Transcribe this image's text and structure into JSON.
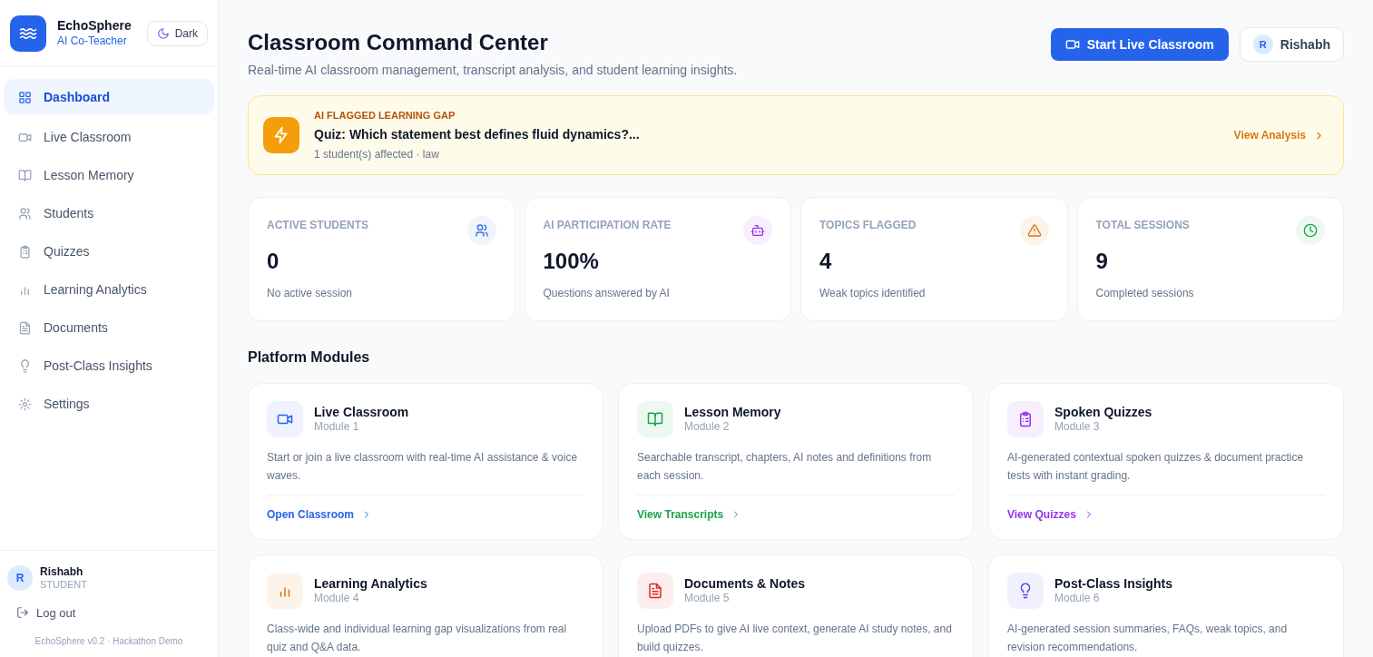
{
  "brand": {
    "name": "EchoSphere",
    "tagline": "AI Co-Teacher",
    "theme_button": "Dark"
  },
  "sidebar": {
    "items": [
      {
        "label": "Dashboard",
        "selected": true
      },
      {
        "label": "Live Classroom",
        "selected": false
      },
      {
        "label": "Lesson Memory",
        "selected": false
      },
      {
        "label": "Students",
        "selected": false
      },
      {
        "label": "Quizzes",
        "selected": false
      },
      {
        "label": "Learning Analytics",
        "selected": false
      },
      {
        "label": "Documents",
        "selected": false
      },
      {
        "label": "Post-Class Insights",
        "selected": false
      },
      {
        "label": "Settings",
        "selected": false
      }
    ]
  },
  "user": {
    "avatar": "R",
    "name": "Rishabh",
    "role": "STUDENT"
  },
  "logout": "Log out",
  "footer": "EchoSphere v0.2 · Hackathon Demo",
  "header": {
    "title": "Classroom Command Center",
    "subtitle": "Real-time AI classroom management, transcript analysis, and student learning insights.",
    "primary_button": "Start Live Classroom",
    "profile": {
      "avatar": "R",
      "name": "Rishabh"
    }
  },
  "alert": {
    "label": "AI FLAGGED LEARNING GAP",
    "title": "Quiz: Which statement best defines fluid dynamics?...",
    "meta": "1 student(s) affected · law",
    "action": "View Analysis"
  },
  "stats": [
    {
      "label": "ACTIVE STUDENTS",
      "value": "0",
      "caption": "No active session",
      "color": "#3b6fd6"
    },
    {
      "label": "AI PARTICIPATION RATE",
      "value": "100%",
      "caption": "Questions answered by AI",
      "color": "#9333ea"
    },
    {
      "label": "TOPICS FLAGGED",
      "value": "4",
      "caption": "Weak topics identified",
      "color": "#d97706"
    },
    {
      "label": "TOTAL SESSIONS",
      "value": "9",
      "caption": "Completed sessions",
      "color": "#16a34a"
    }
  ],
  "modules_heading": "Platform Modules",
  "modules": [
    {
      "title": "Live Classroom",
      "module": "Module 1",
      "description": "Start or join a live classroom with real-time AI assistance & voice waves.",
      "link": "Open Classroom",
      "color": "#2563eb"
    },
    {
      "title": "Lesson Memory",
      "module": "Module 2",
      "description": "Searchable transcript, chapters, AI notes and definitions from each session.",
      "link": "View Transcripts",
      "color": "#16a34a"
    },
    {
      "title": "Spoken Quizzes",
      "module": "Module 3",
      "description": "AI-generated contextual spoken quizzes & document practice tests with instant grading.",
      "link": "View Quizzes",
      "color": "#9333ea"
    },
    {
      "title": "Learning Analytics",
      "module": "Module 4",
      "description": "Class-wide and individual learning gap visualizations from real quiz and Q&A data.",
      "color": "#d97706"
    },
    {
      "title": "Documents & Notes",
      "module": "Module 5",
      "description": "Upload PDFs to give AI live context, generate AI study notes, and build quizzes.",
      "color": "#dc2626"
    },
    {
      "title": "Post-Class Insights",
      "module": "Module 6",
      "description": "AI-generated session summaries, FAQs, weak topics, and revision recommendations.",
      "color": "#4f46e5"
    }
  ]
}
